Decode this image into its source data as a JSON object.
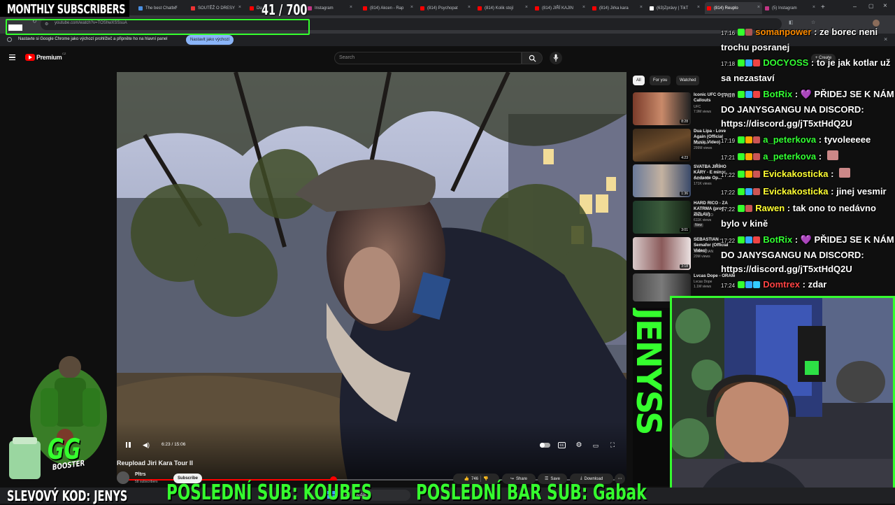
{
  "browser": {
    "tabs": [
      {
        "label": "The best Chatbo"
      },
      {
        "label": "SOUTĚŽ O DRESY"
      },
      {
        "label": "Du"
      },
      {
        "label": "Instagram"
      },
      {
        "label": "(814) Akcen - Rap"
      },
      {
        "label": "(814) Psychopat"
      },
      {
        "label": "(814) Kolik stojí"
      },
      {
        "label": "(814) JIŘÍ KAJIN"
      },
      {
        "label": "(814) Jirka kara"
      },
      {
        "label": "(63)Zprávy | TikT"
      },
      {
        "label": "(814) Reuplo"
      },
      {
        "label": "(5) Instagram"
      }
    ],
    "url": "youtube.com/watch?v=TOShwXSSsuA",
    "info_message": "Nastavte si Google Chrome jako výchozí prohlížeč a připněte ho na hlavní panel",
    "info_button": "Nastavit jako výchozí"
  },
  "youtube": {
    "logo_label": "Premium",
    "logo_sup": "CZ",
    "search_placeholder": "Search",
    "create_label": "Create",
    "chips": [
      "All",
      "For you",
      "Watched"
    ],
    "player": {
      "time": "6:23 / 15:06",
      "progress": 0.423
    },
    "video_title": "Reupload Jiri Kara Tour II",
    "channel_name": "Pltrs",
    "channel_subs": "58 subscribers",
    "subscribe_label": "Subscribe",
    "likes": "746",
    "share_label": "Share",
    "save_label": "Save",
    "download_label": "Download",
    "recommendations": [
      {
        "title": "Iconic UFC Octagon Callouts",
        "channel": "UFC",
        "views": "7.9M views",
        "duration": "8:28"
      },
      {
        "title": "Dua Lipa - Love Again (Official Music Video)",
        "channel": "Dua Lipa",
        "views": "299M views",
        "duration": "4:23"
      },
      {
        "title": "SVATBA JIŘÍHO KÁRY - E minor Andante Op...",
        "channel": "V.O.X. TV",
        "views": "171K views",
        "duration": "1:36"
      },
      {
        "title": "HARD RICO - ZA KATRMA (prod. ZIZLAV)",
        "channel": "HARD RICO",
        "views": "611K views",
        "badge": "New",
        "duration": "3:01"
      },
      {
        "title": "SEBASTIAN - Semafor (Official Video)",
        "channel": "SEBASTIAN",
        "views": "20M views",
        "duration": "3:18"
      },
      {
        "title": "Lvcas Dope - ORAM",
        "channel": "Lvcas Dope",
        "views": "1.1M views",
        "duration": ""
      }
    ]
  },
  "chat": [
    {
      "time": "17:16",
      "user": "somanpower",
      "user_color": "#ff8c00",
      "text": "ze borec neni trochu posranej"
    },
    {
      "time": "17:18",
      "user": "DOCYOSS",
      "user_color": "#33ff33",
      "text": "to je jak kotlar už sa nezastaví"
    },
    {
      "time": "17:18",
      "user": "BotRix",
      "user_color": "#33ff33",
      "text": "💜 PŘIDEJ SE K NÁM DO JANYSGANGU NA DISCORD: https://discord.gg/jT5xtHdQ2U"
    },
    {
      "time": "17:19",
      "user": "a_peterkova",
      "user_color": "#33ff33",
      "text": "tyvoleeeee"
    },
    {
      "time": "17:21",
      "user": "a_peterkova",
      "user_color": "#33ff33",
      "text": ""
    },
    {
      "time": "17:22",
      "user": "Evickakosticka",
      "user_color": "#ffff33",
      "text": ""
    },
    {
      "time": "17:22",
      "user": "Evickakosticka",
      "user_color": "#ffff33",
      "text": "jinej vesmir"
    },
    {
      "time": "17:22",
      "user": "Rawen",
      "user_color": "#ffff33",
      "text": "tak ono to nedávno bylo v kině"
    },
    {
      "time": "17:22",
      "user": "BotRix",
      "user_color": "#33ff33",
      "text": "💜 PŘIDEJ SE K NÁM DO JANYSGANGU NA DISCORD: https://discord.gg/jT5xtHdQ2U"
    },
    {
      "time": "17:24",
      "user": "Domtrex",
      "user_color": "#ff4444",
      "text": "zdar"
    }
  ],
  "overlay": {
    "monthly_label": "MONTHLY SUBSCRIBERS",
    "sub_count": "41 / 700",
    "code_label": "SLEVOVÝ KOD: JENYS",
    "last_sub": "POSLEDNÍ SUB: KOUBES",
    "last_bar_sub": "POSLEDNÍ BAR SUB: Gabak",
    "side_banner": "JENYSS",
    "booster_label": "BOOSTER",
    "taskbar_search": "Hledat"
  },
  "colors": {
    "overlay_green": "#35ff2e",
    "youtube_red": "#ff0000",
    "bg": "#0f0f0f"
  }
}
